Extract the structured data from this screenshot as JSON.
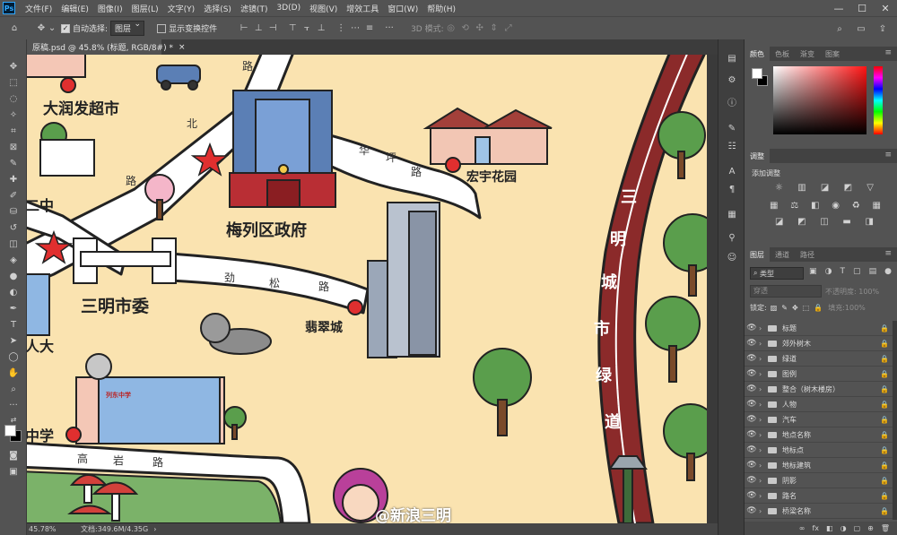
{
  "menubar": {
    "logo": "Ps",
    "items": [
      "文件(F)",
      "编辑(E)",
      "图像(I)",
      "图层(L)",
      "文字(Y)",
      "选择(S)",
      "滤镜(T)",
      "3D(D)",
      "视图(V)",
      "增效工具",
      "窗口(W)",
      "帮助(H)"
    ],
    "window_minimize": "—",
    "window_restore": "☐",
    "window_close": "✕"
  },
  "options_bar": {
    "auto_select_label": "自动选择:",
    "auto_select_checked": true,
    "auto_select_target": "图层",
    "show_transform_label": "显示变换控件",
    "show_transform_checked": false,
    "mode_3d_label": "3D 模式:",
    "more_label": "···"
  },
  "document_tab": {
    "title": "原稿.psd @ 45.8% (标题, RGB/8#) *",
    "close": "×"
  },
  "status_bar": {
    "zoom": "45.78%",
    "doc_info": "文档:349.6M/4.35G",
    "arrow": "›"
  },
  "map": {
    "labels": {
      "supermarket": "大润发超市",
      "government": "梅列区政府",
      "hongyu": "宏宇花园",
      "party_committee": "三明市委",
      "feicui": "翡翠城",
      "er_zhong": "二中",
      "ren_da": "人大",
      "xue": "中学",
      "greenway": [
        "三",
        "明",
        "城",
        "市",
        "绿",
        "道"
      ]
    },
    "roads": {
      "huaping": [
        "华",
        "坪",
        "路"
      ],
      "jinsong": [
        "劲",
        "松",
        "路"
      ],
      "gaoyan": [
        "高",
        "岩",
        "路"
      ],
      "north_road": [
        "北",
        "路"
      ],
      "top_road": [
        "路"
      ]
    },
    "building_sign": "列东中学",
    "watermark": "@新浪三明"
  },
  "right_panel": {
    "color_tabs": [
      "颜色",
      "色板",
      "渐变",
      "图案"
    ],
    "adjust_tabs": [
      "调整"
    ],
    "adjust_label": "添加调整",
    "layer_tabs": [
      "图层",
      "通道",
      "路径"
    ],
    "layer_filter": "类型",
    "blend_mode": "穿透",
    "opacity_label": "不透明度:",
    "opacity_value": "100%",
    "lock_label": "锁定:",
    "fill_label": "填充:",
    "fill_value": "100%",
    "layers": [
      "标题",
      "郊外树木",
      "绿道",
      "图例",
      "整合（树木楼房）",
      "人物",
      "汽车",
      "地点名称",
      "地标点",
      "地标建筑",
      "阴影",
      "路名",
      "桥梁名称"
    ],
    "footer_icons": [
      "∞",
      "fx",
      "◧",
      "◑",
      "▢",
      "⊕",
      "🗑"
    ]
  },
  "colors": {
    "foreground": "#ffffff",
    "background": "#000000",
    "map_ground": "#fae3b0",
    "greenway": "#8b2a2a",
    "road": "#ffffff"
  }
}
